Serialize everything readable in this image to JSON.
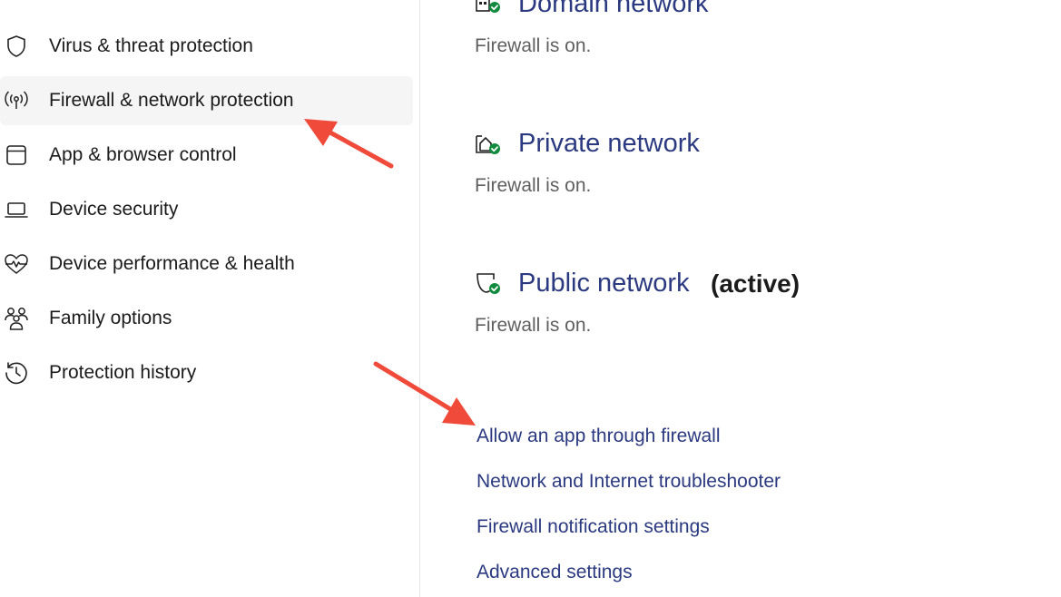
{
  "sidebar": {
    "items": [
      {
        "label": "Virus & threat protection",
        "icon": "shield-icon"
      },
      {
        "label": "Firewall & network protection",
        "icon": "wifi-antenna-icon",
        "selected": true
      },
      {
        "label": "App & browser control",
        "icon": "browser-window-icon"
      },
      {
        "label": "Device security",
        "icon": "laptop-icon"
      },
      {
        "label": "Device performance & health",
        "icon": "heart-pulse-icon"
      },
      {
        "label": "Family options",
        "icon": "family-icon"
      },
      {
        "label": "Protection history",
        "icon": "history-icon"
      }
    ]
  },
  "networks": [
    {
      "title": "Domain network",
      "status": "Firewall is on.",
      "icon": "domain-network-icon"
    },
    {
      "title": "Private network",
      "status": "Firewall is on.",
      "icon": "private-network-icon"
    },
    {
      "title": "Public network",
      "active_label": "(active)",
      "status": "Firewall is on.",
      "icon": "public-network-icon"
    }
  ],
  "links": [
    "Allow an app through firewall",
    "Network and Internet troubleshooter",
    "Firewall notification settings",
    "Advanced settings"
  ],
  "colors": {
    "link": "#2b3a80",
    "status_check": "#108a3c",
    "annotation_arrow": "#f04a3a",
    "selected_bg": "#f5f5f5"
  }
}
